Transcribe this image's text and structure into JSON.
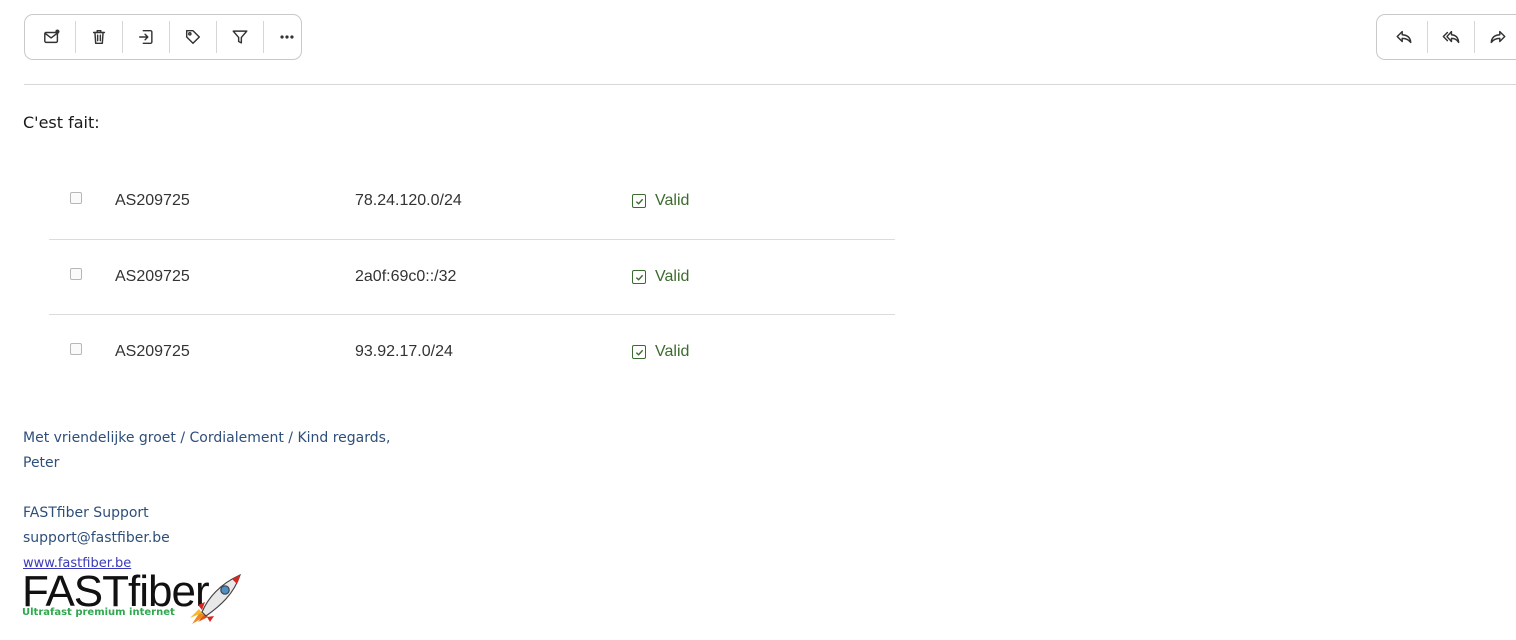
{
  "toolbar": {
    "left_buttons": [
      {
        "icon": "mark-unread-icon"
      },
      {
        "icon": "trash-icon"
      },
      {
        "icon": "move-to-icon"
      },
      {
        "icon": "tag-icon"
      },
      {
        "icon": "filter-icon"
      },
      {
        "icon": "more-icon"
      }
    ],
    "right_buttons": [
      {
        "icon": "reply-icon"
      },
      {
        "icon": "reply-all-icon"
      },
      {
        "icon": "forward-icon"
      }
    ]
  },
  "message": {
    "intro": "C'est fait:",
    "roa_rows": [
      {
        "asn": "AS209725",
        "prefix": "78.24.120.0/24",
        "status": "Valid"
      },
      {
        "asn": "AS209725",
        "prefix": "2a0f:69c0::/32",
        "status": "Valid"
      },
      {
        "asn": "AS209725",
        "prefix": "93.92.17.0/24",
        "status": "Valid"
      }
    ]
  },
  "signature": {
    "greeting": "Met vriendelijke groet / Cordialement / Kind regards,",
    "name": "Peter",
    "company_line": "FASTfiber Support",
    "email": "support@fastfiber.be",
    "website": "www.fastfiber.be",
    "logo_text": "FASTfiber",
    "logo_tagline": "Ultrafast premium internet"
  },
  "colors": {
    "valid_green": "#3b6b2e",
    "signature_blue": "#2e4f7a",
    "link": "#3a3ab8",
    "tagline_green": "#2fa84f"
  }
}
